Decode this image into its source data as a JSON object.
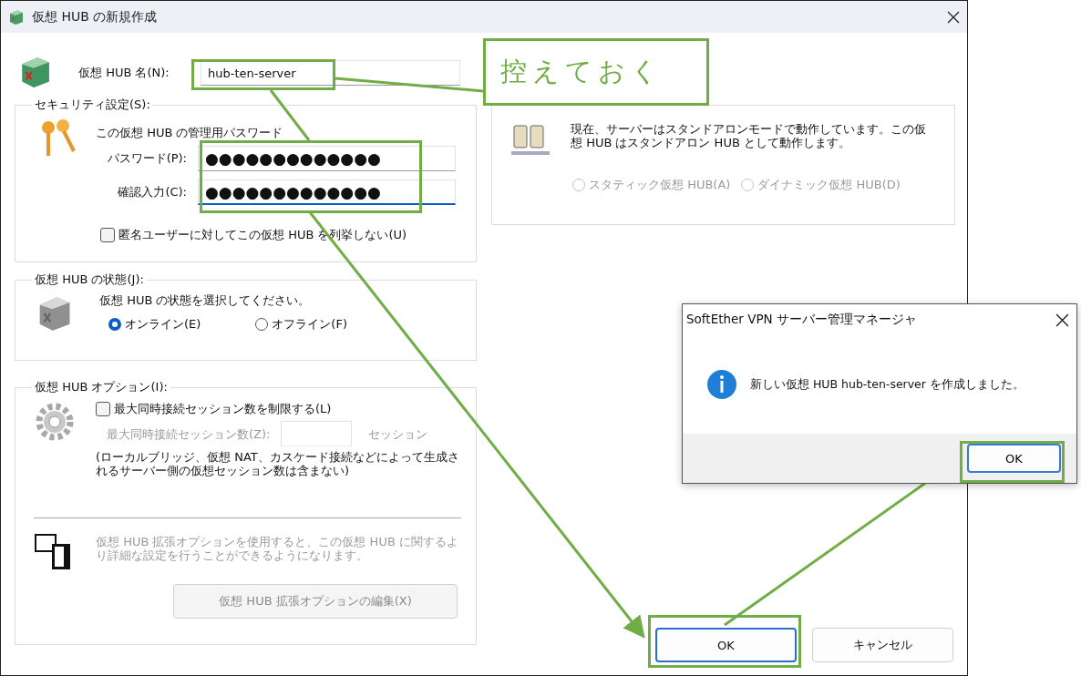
{
  "window": {
    "title": "仮想 HUB の新規作成"
  },
  "hub_name": {
    "label": "仮想 HUB 名(N):",
    "value": "hub-ten-server"
  },
  "security": {
    "title": "セキュリティ設定(S):",
    "description": "この仮想 HUB の管理用パスワード",
    "password": {
      "label": "パスワード(P):",
      "value": "●●●●●●●●●●●●●",
      "focused": false
    },
    "confirm": {
      "label": "確認入力(C):",
      "value": "●●●●●●●●●●●●●",
      "focused": true
    },
    "anonymous_checkbox": {
      "label": "匿名ユーザーに対してこの仮想 HUB を列挙しない(U)",
      "checked": false
    }
  },
  "state": {
    "title": "仮想 HUB の状態(J):",
    "description": "仮想 HUB の状態を選択してください。",
    "options": [
      {
        "label": "オンライン(E)",
        "selected": true
      },
      {
        "label": "オフライン(F)",
        "selected": false
      }
    ]
  },
  "options": {
    "title": "仮想 HUB オプション(I):",
    "limit_checkbox": {
      "label": "最大同時接続セッション数を制限する(L)",
      "checked": false
    },
    "max_sessions": {
      "label": "最大同時接続セッション数(Z):",
      "unit": "セッション",
      "disabled": true
    },
    "note": "(ローカルブリッジ、仮想 NAT、カスケード接続などによって生成されるサーバー側の仮想セッション数は含まない)",
    "extended_description": "仮想 HUB 拡張オプションを使用すると、この仮想 HUB に関するより詳細な設定を行うことができるようになります。",
    "extended_button": {
      "label": "仮想 HUB 拡張オプションの編集(X)",
      "disabled": true
    }
  },
  "cluster": {
    "description": "現在、サーバーはスタンドアロンモードで動作しています。この仮想 HUB はスタンドアロン HUB として動作します。",
    "options": [
      {
        "label": "スタティック仮想 HUB(A)",
        "selected": false,
        "disabled": true
      },
      {
        "label": "ダイナミック仮想 HUB(D)",
        "selected": false,
        "disabled": true
      }
    ]
  },
  "buttons": [
    {
      "label": "OK",
      "kind": "default"
    },
    {
      "label": "キャンセル",
      "kind": "normal"
    }
  ],
  "message_box": {
    "title": "SoftEther VPN サーバー管理マネージャ",
    "message": "新しい仮想 HUB hub-ten-server を作成しました。",
    "button": "OK"
  },
  "annotation": {
    "callout": "控えておく"
  }
}
